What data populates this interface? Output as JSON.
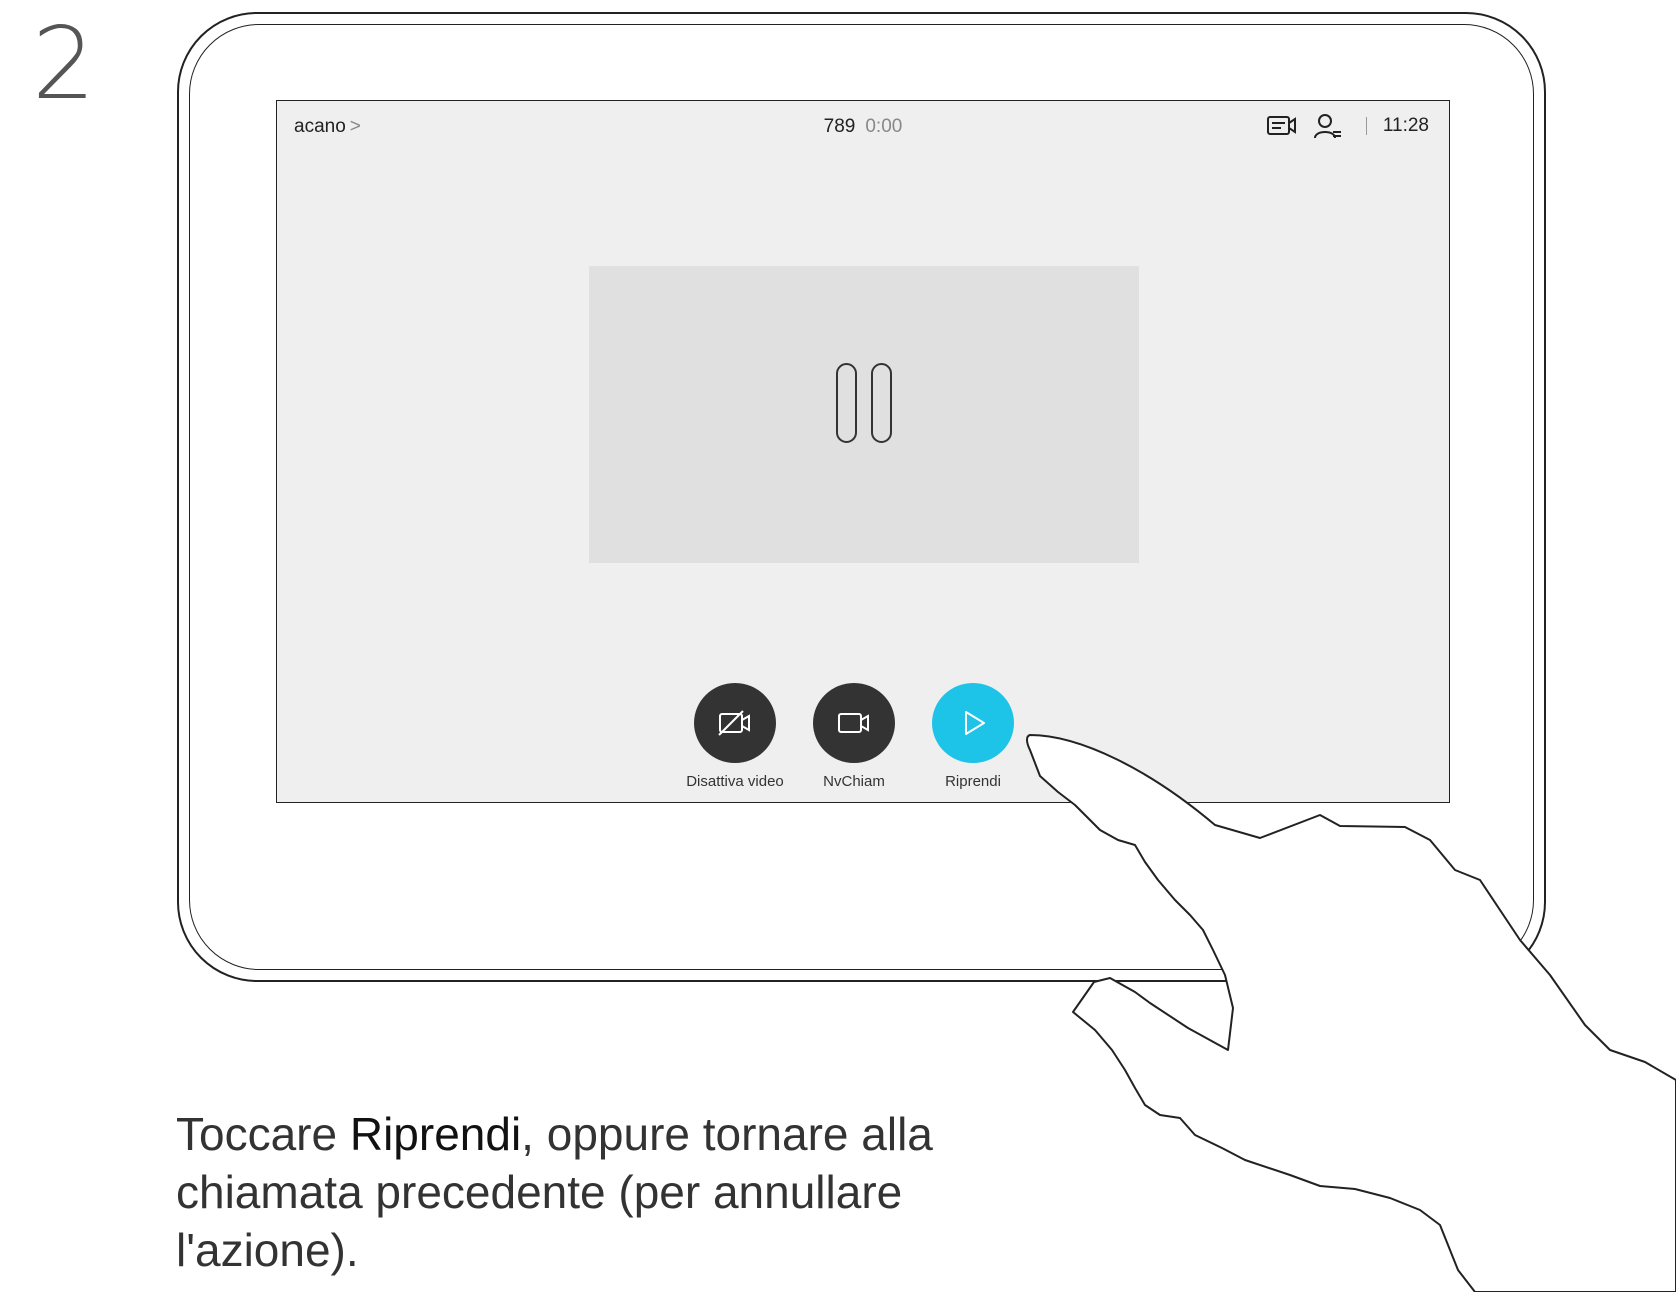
{
  "step": {
    "number": "2"
  },
  "topbar": {
    "caller": "acano",
    "caller_chevron": ">",
    "call_number": "789",
    "call_duration": "0:00",
    "clock": "11:28",
    "icons": [
      "video-layout-icon",
      "participants-icon"
    ]
  },
  "video": {
    "state_icon": "pause-icon"
  },
  "controls": [
    {
      "label": "Disattiva video",
      "icon": "video-off-icon",
      "color": "#333333"
    },
    {
      "label": "NvChiam",
      "icon": "video-camera-icon",
      "color": "#333333"
    },
    {
      "label": "Riprendi",
      "icon": "play-icon",
      "color": "#1ec3e8"
    }
  ],
  "instruction": {
    "before": "Toccare ",
    "bold": "Riprendi",
    "after": ", oppure tornare alla chiamata precedente (per annullare l'azione)."
  }
}
